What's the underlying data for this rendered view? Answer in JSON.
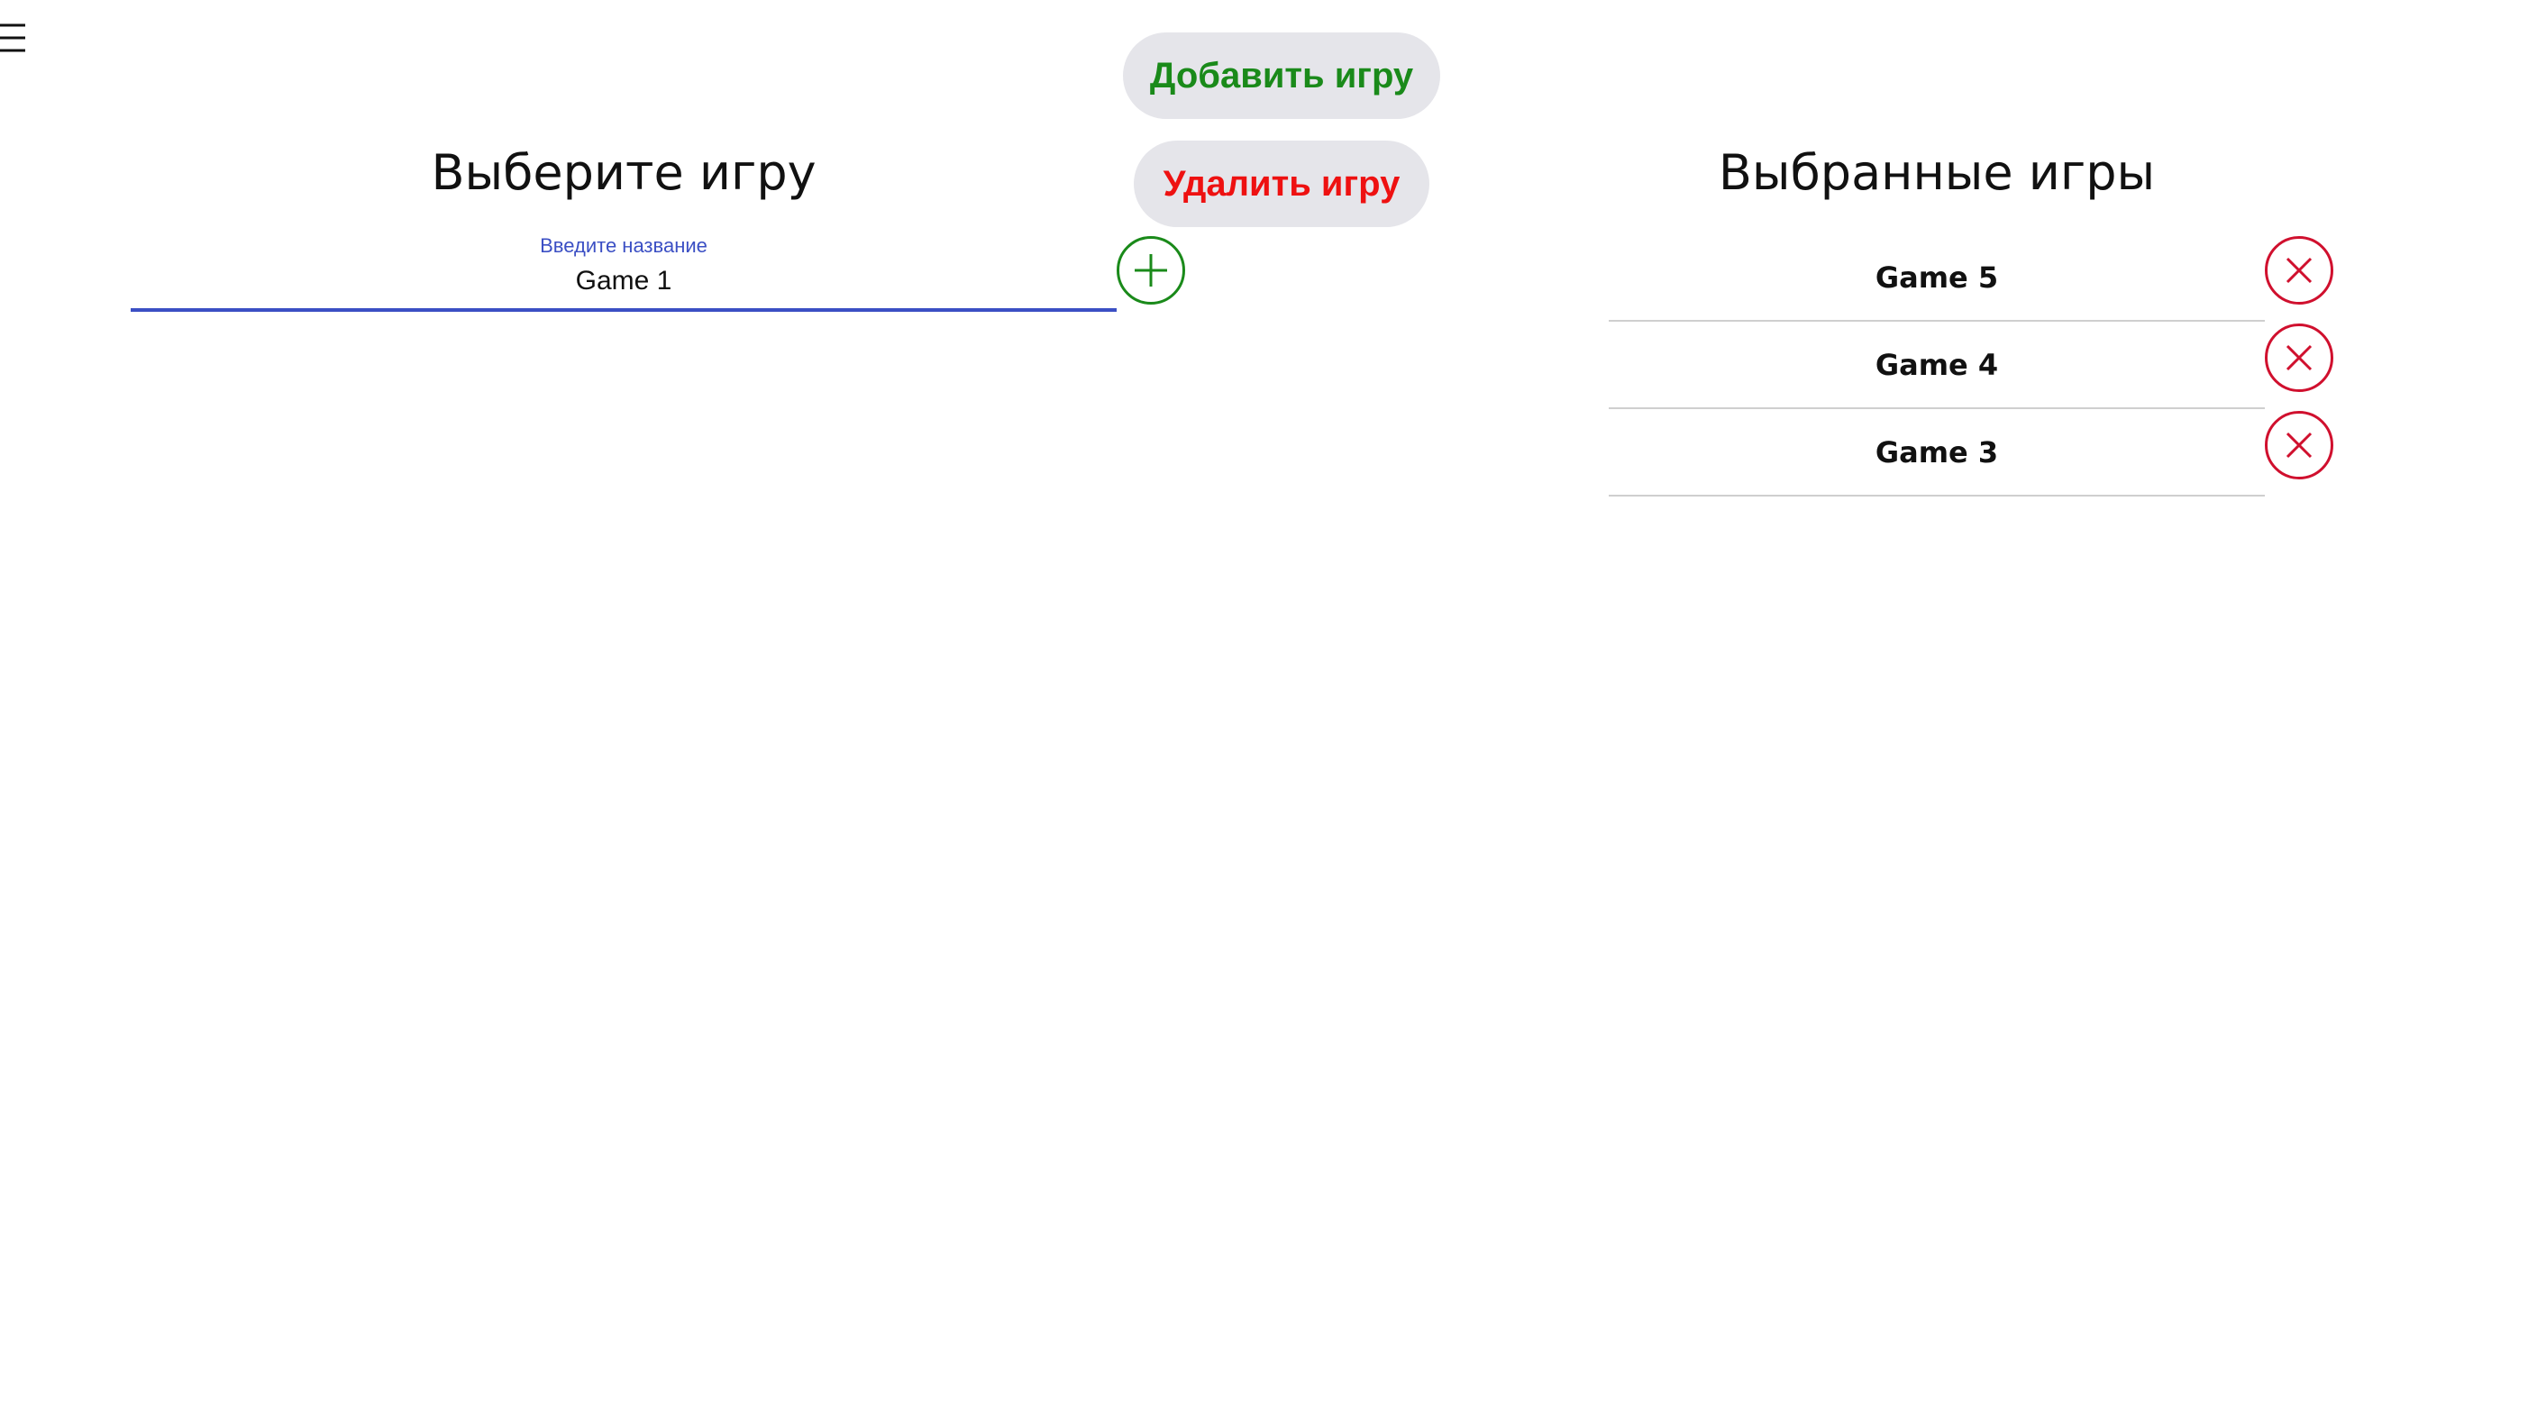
{
  "menu": {
    "icon": "hamburger-icon"
  },
  "actions": {
    "add_game": {
      "label": "Добавить игру",
      "color": "#1a8a1a"
    },
    "delete_game": {
      "label": "Удалить игру",
      "color": "#ee1111"
    }
  },
  "select_panel": {
    "title": "Выберите игру",
    "input": {
      "label": "Введите название",
      "value": "Game 1"
    },
    "add_icon": "plus-circle-icon"
  },
  "selected_panel": {
    "title": "Выбранные игры",
    "items": [
      {
        "label": "Game 5",
        "remove_icon": "close-circle-icon"
      },
      {
        "label": "Game 4",
        "remove_icon": "close-circle-icon"
      },
      {
        "label": "Game 3",
        "remove_icon": "close-circle-icon"
      }
    ]
  },
  "colors": {
    "accent_blue": "#3b4fc4",
    "remove_red": "#d0102e"
  }
}
